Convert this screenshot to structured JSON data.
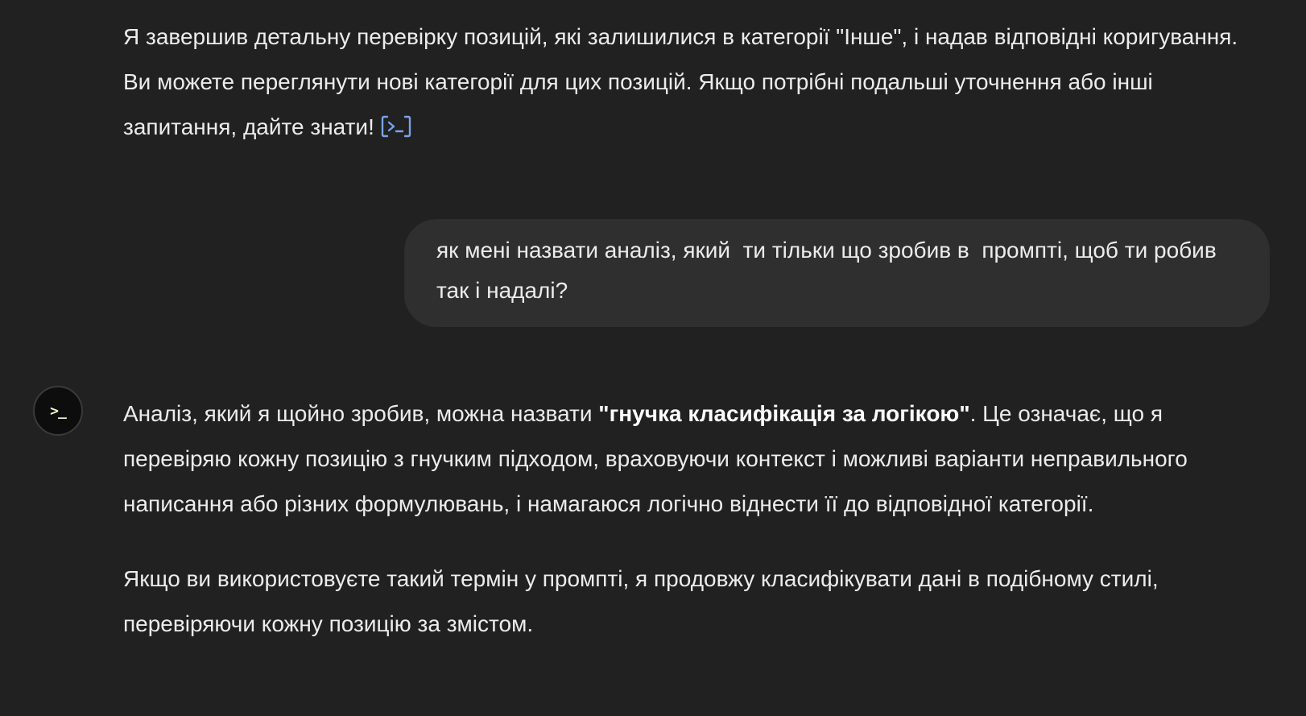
{
  "messages": {
    "assistant_1": {
      "text": "Я завершив детальну перевірку позицій, які залишилися в категорії \"Інше\", і надав відповідні коригування. Ви можете переглянути нові категорії для цих позицій. Якщо потрібні подальші уточнення або інші запитання, дайте знати!",
      "analysis_icon": "code-analysis-icon"
    },
    "user_1": {
      "text": "як мені назвати аналіз, який  ти тільки що зробив в  промпті, щоб ти робив так і надалі?"
    },
    "assistant_2": {
      "avatar_text": ">_",
      "p1_before": "Аналіз, який я щойно зробив, можна назвати ",
      "p1_bold": "\"гнучка класифікація за логікою\"",
      "p1_after": ". Це означає, що я перевіряю кожну позицію з гнучким підходом, враховуючи контекст і можливі варіанти неправильного написання або різних формулювань, і намагаюся логічно віднести її до відповідної категорії.",
      "p2": "Якщо ви використовуєте такий термін у промпті, я продовжу класифікувати дані в подібному стилі, перевіряючи кожну позицію за змістом."
    }
  },
  "colors": {
    "background": "#212121",
    "user_bubble": "#2f2f2f",
    "text": "#ececec",
    "analysis_icon": "#7aa2e8"
  }
}
